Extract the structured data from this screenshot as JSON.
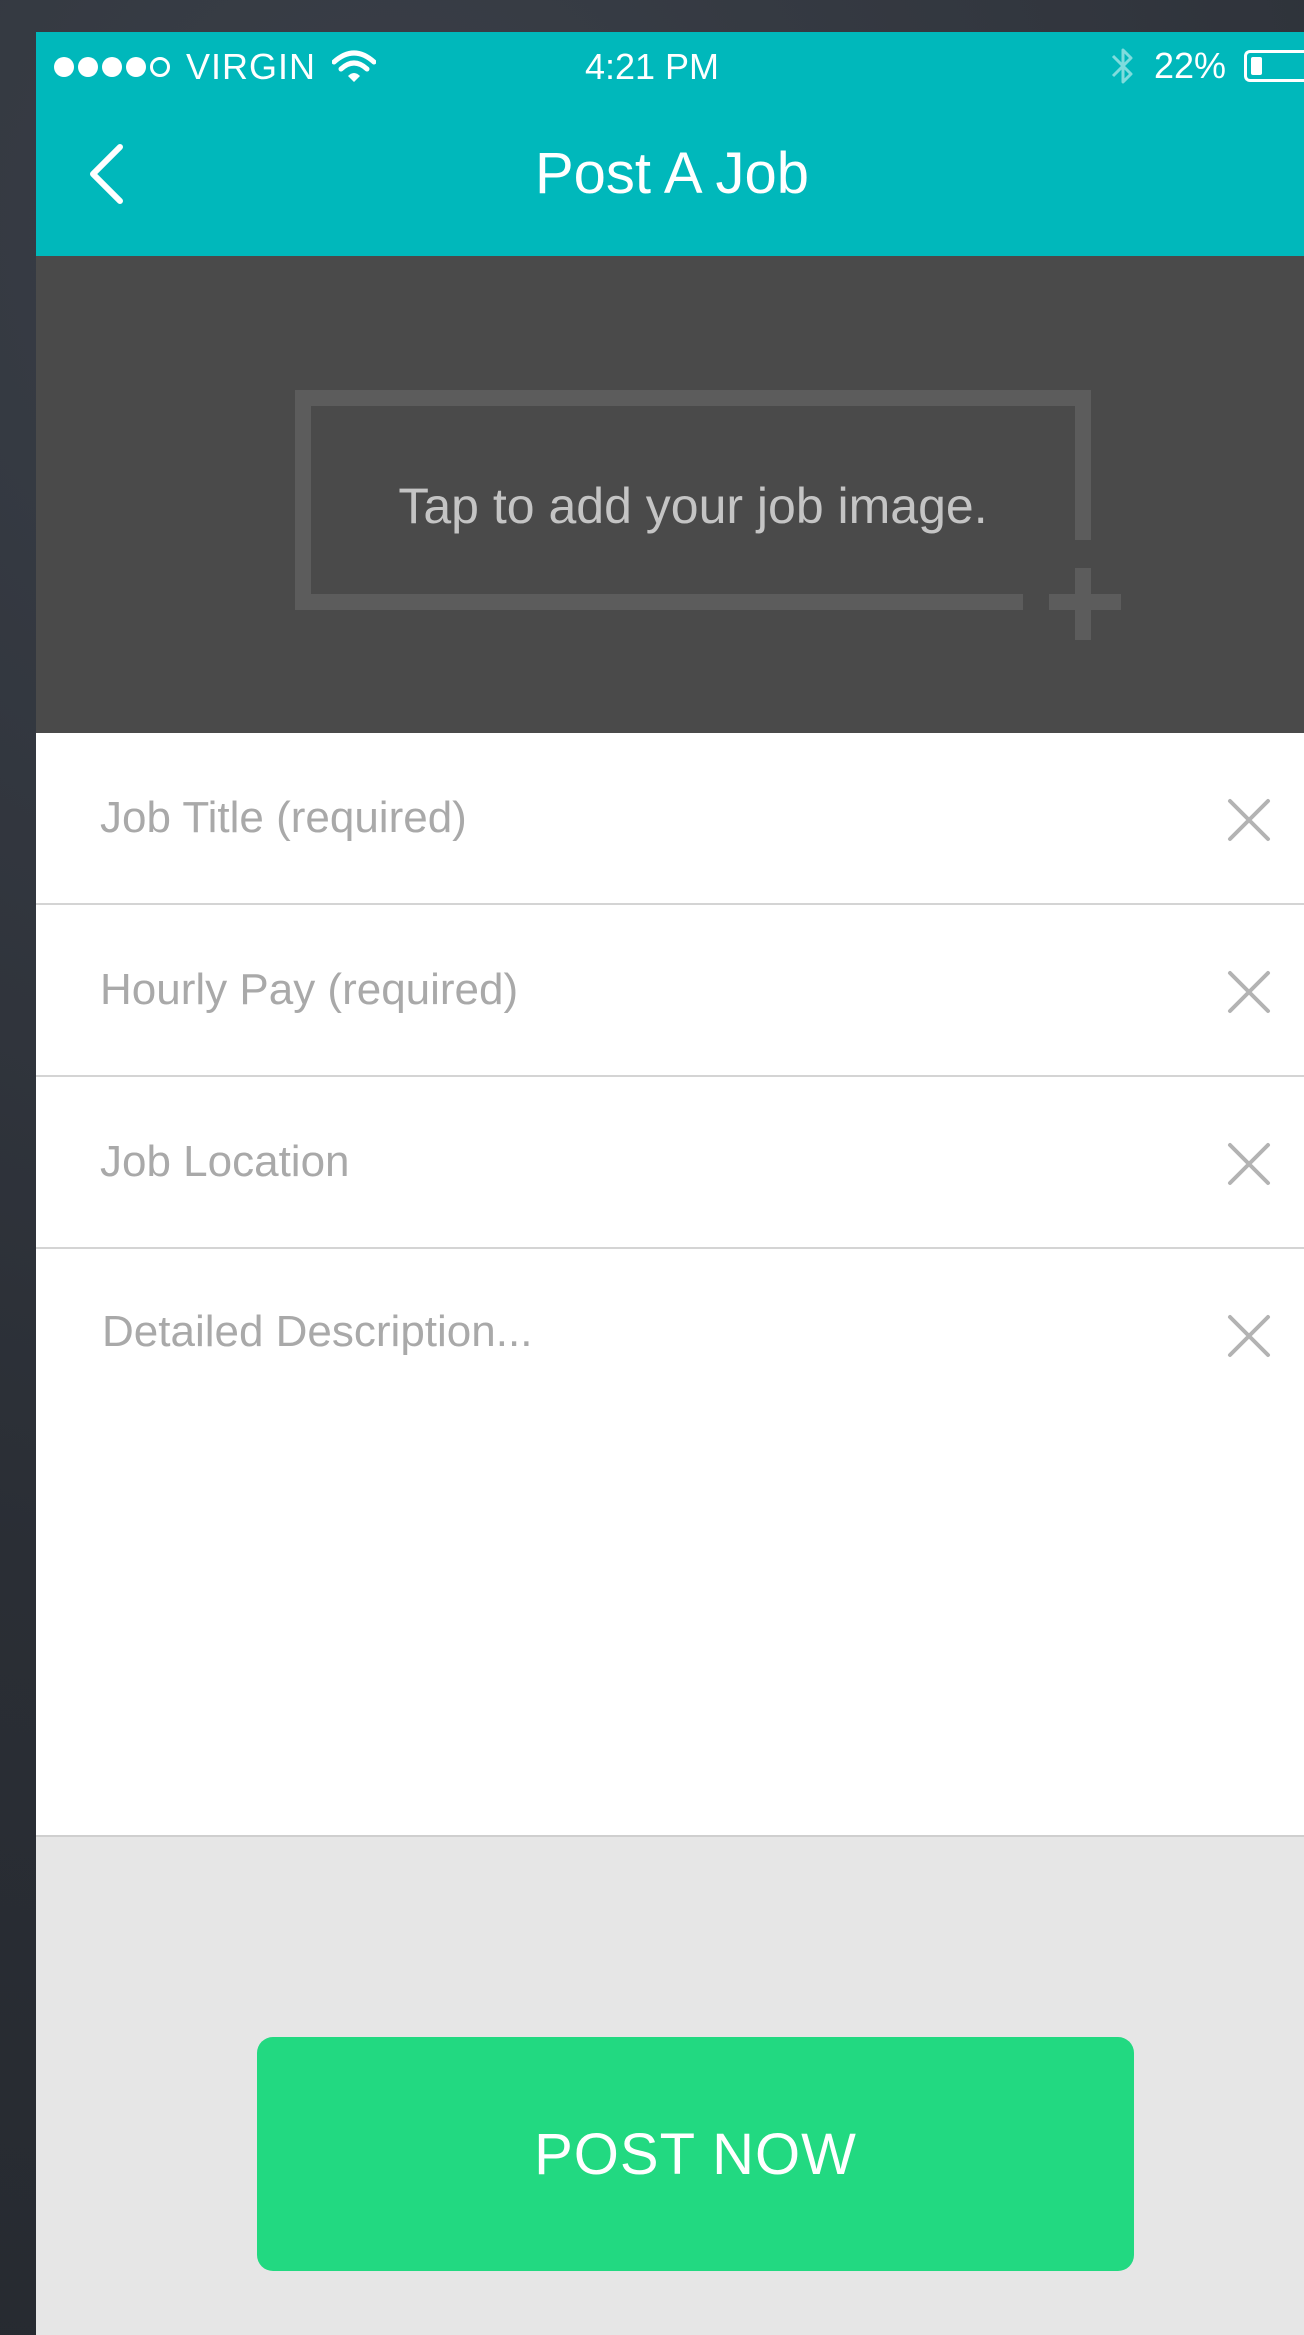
{
  "status_bar": {
    "carrier": "VIRGIN",
    "time": "4:21 PM",
    "battery": "22%",
    "battery_level": 0.22,
    "signal_bars_filled": 4,
    "signal_bars_total": 5
  },
  "nav": {
    "title": "Post A Job",
    "back_icon": "chevron-left-icon"
  },
  "image_upload": {
    "prompt": "Tap to add your job image.",
    "icon": "plus-icon"
  },
  "form": {
    "job_title": {
      "placeholder": "Job Title (required)",
      "value": ""
    },
    "hourly_pay": {
      "placeholder": "Hourly Pay (required)",
      "value": ""
    },
    "job_location": {
      "placeholder": "Job Location",
      "value": ""
    },
    "description": {
      "placeholder": "Detailed Description...",
      "value": ""
    },
    "clear_icon": "close-icon"
  },
  "actions": {
    "post_label": "POST NOW"
  },
  "colors": {
    "header": "#00b8bb",
    "image_area": "#4a4a4a",
    "post_button": "#22d981",
    "footer": "#e6e6e6"
  }
}
